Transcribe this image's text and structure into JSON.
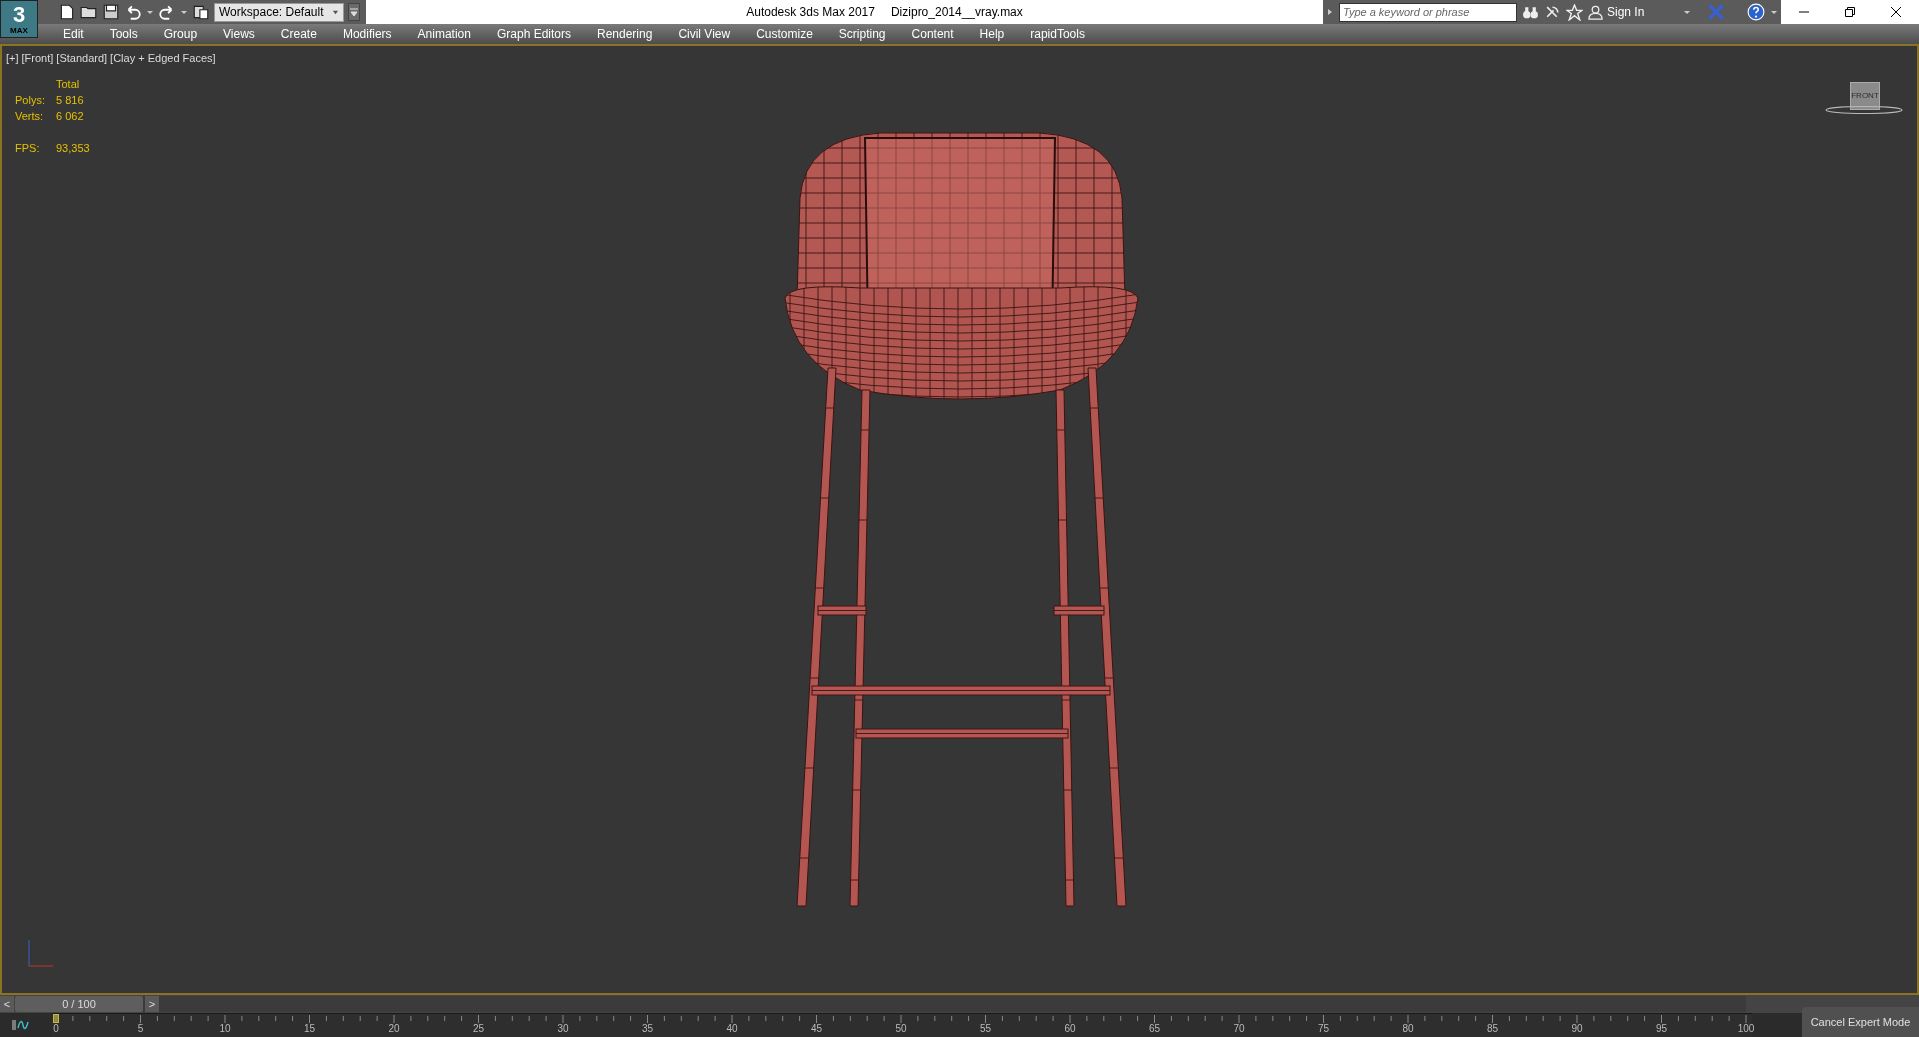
{
  "app_button": {
    "label": "3",
    "sublabel": "MAX"
  },
  "workspace": {
    "value": "Workspace: Default"
  },
  "window_title": {
    "app": "Autodesk 3ds Max 2017",
    "file": "Dizipro_2014__vray.max"
  },
  "search": {
    "placeholder": "Type a keyword or phrase"
  },
  "sign_in": "Sign In",
  "menu": [
    "Edit",
    "Tools",
    "Group",
    "Views",
    "Create",
    "Modifiers",
    "Animation",
    "Graph Editors",
    "Rendering",
    "Civil View",
    "Customize",
    "Scripting",
    "Content",
    "Help",
    "rapidTools"
  ],
  "viewport": {
    "labels": [
      "[+]",
      "[Front]",
      "[Standard]",
      "[Clay + Edged Faces]"
    ],
    "stats": {
      "header": "Total",
      "rows": [
        {
          "label": "Polys:",
          "value": "5 816"
        },
        {
          "label": "Verts:",
          "value": "6 062"
        }
      ],
      "fps": {
        "label": "FPS:",
        "value": "93,353"
      }
    },
    "viewcube": "FRONT"
  },
  "time_slider": {
    "prev": "<",
    "position": "0 / 100",
    "next": ">",
    "level": 0
  },
  "ruler": {
    "labels": [
      "0",
      "5",
      "10",
      "15",
      "20",
      "25",
      "30",
      "35",
      "40",
      "45",
      "50",
      "55",
      "60",
      "65",
      "70",
      "75",
      "80",
      "85",
      "90",
      "95",
      "100"
    ]
  },
  "expert_mode_button": "Cancel Expert Mode"
}
